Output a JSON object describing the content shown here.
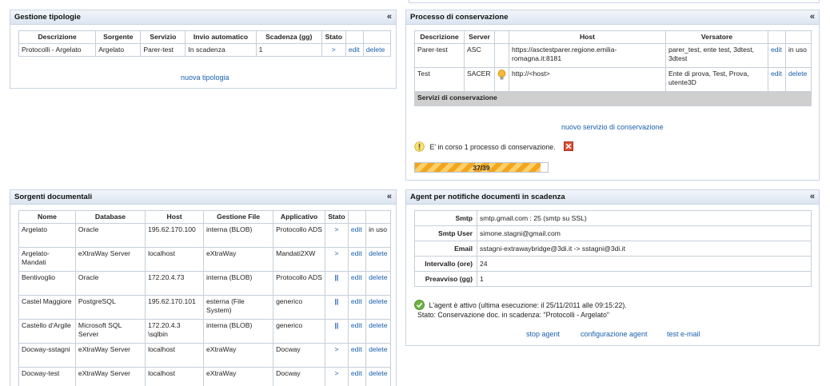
{
  "tipologie": {
    "title": "Gestione tipologie",
    "collapse": "«",
    "headers": [
      "Descrizione",
      "Sorgente",
      "Servizio",
      "Invio automatico",
      "Scadenza (gg)",
      "Stato"
    ],
    "rows": [
      {
        "descrizione": "Protocolli - Argelato",
        "sorgente": "Argelato",
        "servizio": "Parer-test",
        "invio": "In scadenza",
        "scadenza": "1",
        "stato": ">",
        "edit": "edit",
        "delete": "delete"
      }
    ],
    "new_link": "nuova tipologia"
  },
  "conservazione": {
    "title": "Processo di conservazione",
    "collapse": "«",
    "headers": [
      "Descrizione",
      "Server",
      "",
      "Host",
      "Versatore"
    ],
    "rows": [
      {
        "descrizione": "Parer-test",
        "server": "ASC",
        "host": "https://asctestparer.regione.emilia-romagna.it:8181",
        "versatore": "parer_test, ente test, 3dtest, 3dtest",
        "edit": "edit",
        "extra": "in uso"
      },
      {
        "descrizione": "Test",
        "server": "SACER",
        "host": "http://<host>",
        "versatore": "Ente di prova, Test, Prova, utente3D",
        "edit": "edit",
        "extra": "delete"
      }
    ],
    "section_label": "Servizi di conservazione",
    "new_link": "nuovo servizio di conservazione",
    "status_text": "E' in corso 1 processo di conservazione.",
    "progress_label": "37/39",
    "progress_fraction": 0.9487
  },
  "sorgenti": {
    "title": "Sorgenti documentali",
    "collapse": "«",
    "headers": [
      "Nome",
      "Database",
      "Host",
      "Gestione File",
      "Applicativo",
      "Stato"
    ],
    "rows": [
      {
        "nome": "Argelato",
        "db": "Oracle",
        "host": "195.62.170.100",
        "gestione": "interna (BLOB)",
        "app": "Protocollo ADS",
        "stato": ">",
        "edit": "edit",
        "extra": "in uso"
      },
      {
        "nome": "Argelato-Mandati",
        "db": "eXtraWay Server",
        "host": "localhost",
        "gestione": "eXtraWay",
        "app": "Mandati2XW",
        "stato": ">",
        "edit": "edit",
        "extra": "delete"
      },
      {
        "nome": "Bentivoglio",
        "db": "Oracle",
        "host": "172.20.4.73",
        "gestione": "interna (BLOB)",
        "app": "Protocollo ADS",
        "stato": "||",
        "edit": "edit",
        "extra": "delete"
      },
      {
        "nome": "Castel Maggiore",
        "db": "PostgreSQL",
        "host": "195.62.170.101",
        "gestione": "esterna (File System)",
        "app": "generico",
        "stato": "||",
        "edit": "edit",
        "extra": "delete"
      },
      {
        "nome": "Castello d'Argile",
        "db": "Microsoft SQL Server",
        "host": "172.20.4.3 \\sqlbin",
        "gestione": "interna (BLOB)",
        "app": "generico",
        "stato": "||",
        "edit": "edit",
        "extra": "delete"
      },
      {
        "nome": "Docway-sstagni",
        "db": "eXtraWay Server",
        "host": "localhost",
        "gestione": "eXtraWay",
        "app": "Docway",
        "stato": ">",
        "edit": "edit",
        "extra": "delete"
      },
      {
        "nome": "Docway-test",
        "db": "eXtraWay Server",
        "host": "localhost",
        "gestione": "eXtraWay",
        "app": "Docway",
        "stato": ">",
        "edit": "edit",
        "extra": "delete"
      }
    ]
  },
  "agent": {
    "title": "Agent per notifiche documenti in scadenza",
    "collapse": "«",
    "fields": [
      {
        "label": "Smtp",
        "value": "smtp.gmail.com : 25 (smtp su SSL)"
      },
      {
        "label": "Smtp User",
        "value": "simone.stagni@gmail.com"
      },
      {
        "label": "Email",
        "value": "sstagni-extrawaybridge@3di.it -> sstagni@3di.it"
      },
      {
        "label": "Intervallo (ore)",
        "value": "24"
      },
      {
        "label": "Preavviso (gg)",
        "value": "1"
      }
    ],
    "status_line1": "L'agent è attivo (ultima esecuzione: il 25/11/2011 alle 09:15:22).",
    "status_line2": "Stato: Conservazione doc. in scadenza: \"Protocolli - Argelato\"",
    "links": {
      "stop": "stop agent",
      "config": "configurazione agent",
      "test": "test e-mail"
    }
  }
}
